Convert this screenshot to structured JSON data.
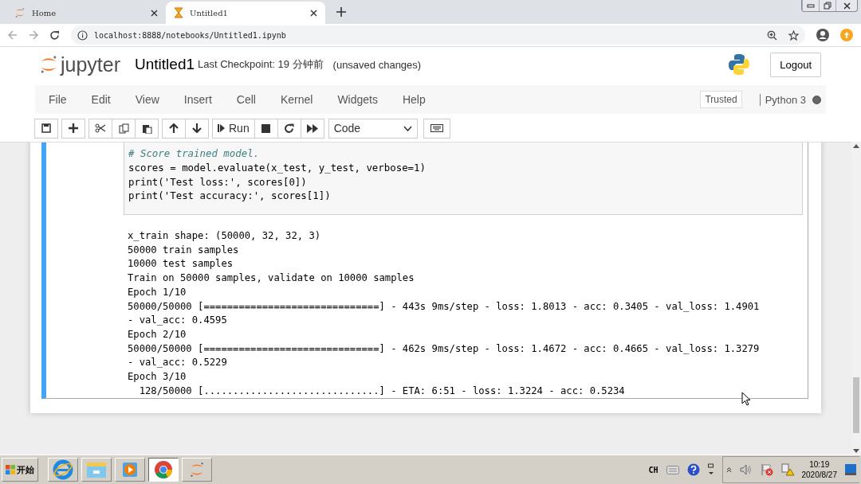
{
  "browser_tabs": [
    {
      "title": "Home",
      "kind": "jupyter",
      "selected": false
    },
    {
      "title": "Untitled1",
      "kind": "hourglass",
      "selected": true
    }
  ],
  "address": "localhost:8888/notebooks/Untitled1.ipynb",
  "header": {
    "logo": "jupyter",
    "notebook_name": "Untitled1",
    "checkpoint": "Last Checkpoint: 19 分钟前",
    "unsaved": "(unsaved changes)",
    "logout": "Logout"
  },
  "menu": [
    "File",
    "Edit",
    "View",
    "Insert",
    "Cell",
    "Kernel",
    "Widgets",
    "Help"
  ],
  "trusted": "Trusted",
  "kernel": {
    "name": "Python 3",
    "busy": true
  },
  "toolbar": {
    "run": "Run",
    "cell_type": "Code"
  },
  "cell": {
    "selected": true,
    "code": [
      {
        "kind": "comment",
        "text": "# Score trained model."
      },
      {
        "kind": "code",
        "text": "scores = model.evaluate(x_test, y_test, verbose=1)"
      },
      {
        "kind": "code",
        "text": "print('Test loss:', scores[0])"
      },
      {
        "kind": "code",
        "text": "print('Test accuracy:', scores[1])"
      }
    ],
    "output": [
      "x_train shape: (50000, 32, 32, 3)",
      "50000 train samples",
      "10000 test samples",
      "Train on 50000 samples, validate on 10000 samples",
      "Epoch 1/10",
      "50000/50000 [==============================] - 443s 9ms/step - loss: 1.8013 - acc: 0.3405 - val_loss: 1.4901",
      "- val_acc: 0.4595",
      "Epoch 2/10",
      "50000/50000 [==============================] - 462s 9ms/step - loss: 1.4672 - acc: 0.4665 - val_loss: 1.3279",
      "- val_acc: 0.5229",
      "Epoch 3/10",
      "  128/50000 [..............................] - ETA: 6:51 - loss: 1.3224 - acc: 0.5234"
    ]
  },
  "taskbar": {
    "start": "开始",
    "apps": [
      {
        "kind": "ie",
        "selected": false
      },
      {
        "kind": "folder",
        "selected": false
      },
      {
        "kind": "media",
        "selected": false
      },
      {
        "kind": "chrome",
        "selected": true
      },
      {
        "kind": "jupyter",
        "selected": false
      }
    ],
    "language": "CH",
    "time": "10:19",
    "date": "2020/8/27"
  }
}
